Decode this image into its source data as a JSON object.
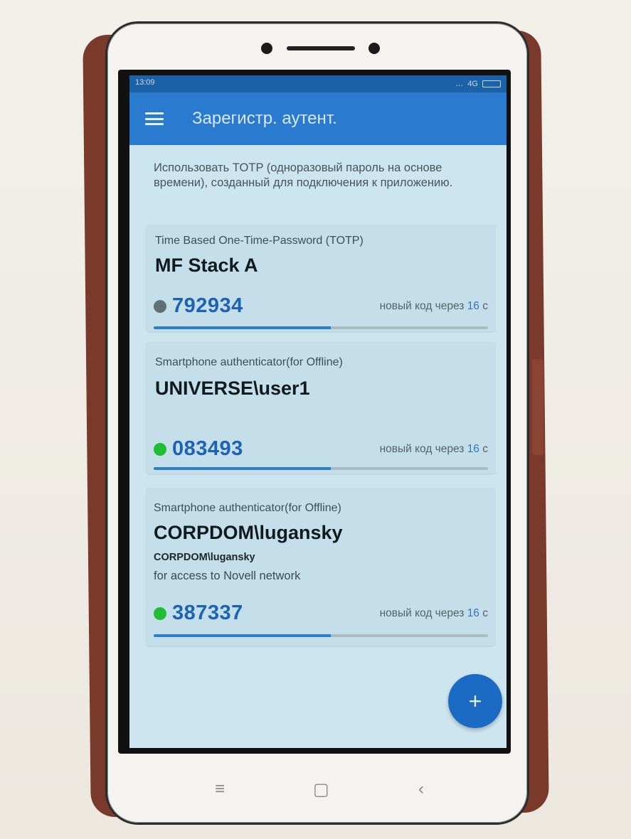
{
  "statusbar": {
    "time": "13:09",
    "network": "4G",
    "signal": "…"
  },
  "appbar": {
    "title": "Зарегистр. аутент."
  },
  "intro_text": "Использовать TOTP (одноразовый пароль на основе времени), созданный для подключения к приложению.",
  "cards": [
    {
      "type": "Time Based One-Time-Password (TOTP)",
      "name": "MF Stack A",
      "code": "792934",
      "status_color": "#5f7078",
      "timer_prefix": "новый код через",
      "timer_seconds": "16",
      "timer_unit": "с",
      "progress": 0.53
    },
    {
      "type": "Smartphone authenticator(for Offline)",
      "name": "UNIVERSE\\user1",
      "code": "083493",
      "status_color": "#1fbe33",
      "timer_prefix": "новый код через",
      "timer_seconds": "16",
      "timer_unit": "с",
      "progress": 0.53
    },
    {
      "type": "Smartphone authenticator(for Offline)",
      "name": "CORPDOM\\lugansky",
      "subtitle": "CORPDOM\\lugansky",
      "description": "for access to Novell network",
      "code": "387337",
      "status_color": "#1fbe33",
      "timer_prefix": "новый код через",
      "timer_seconds": "16",
      "timer_unit": "с",
      "progress": 0.53
    }
  ],
  "fab": {
    "label": "+"
  },
  "nav": {
    "menu": "≡",
    "home": "▢",
    "back": "‹"
  },
  "colors": {
    "appbar": "#2a7ad0",
    "accent": "#1d63b5"
  }
}
